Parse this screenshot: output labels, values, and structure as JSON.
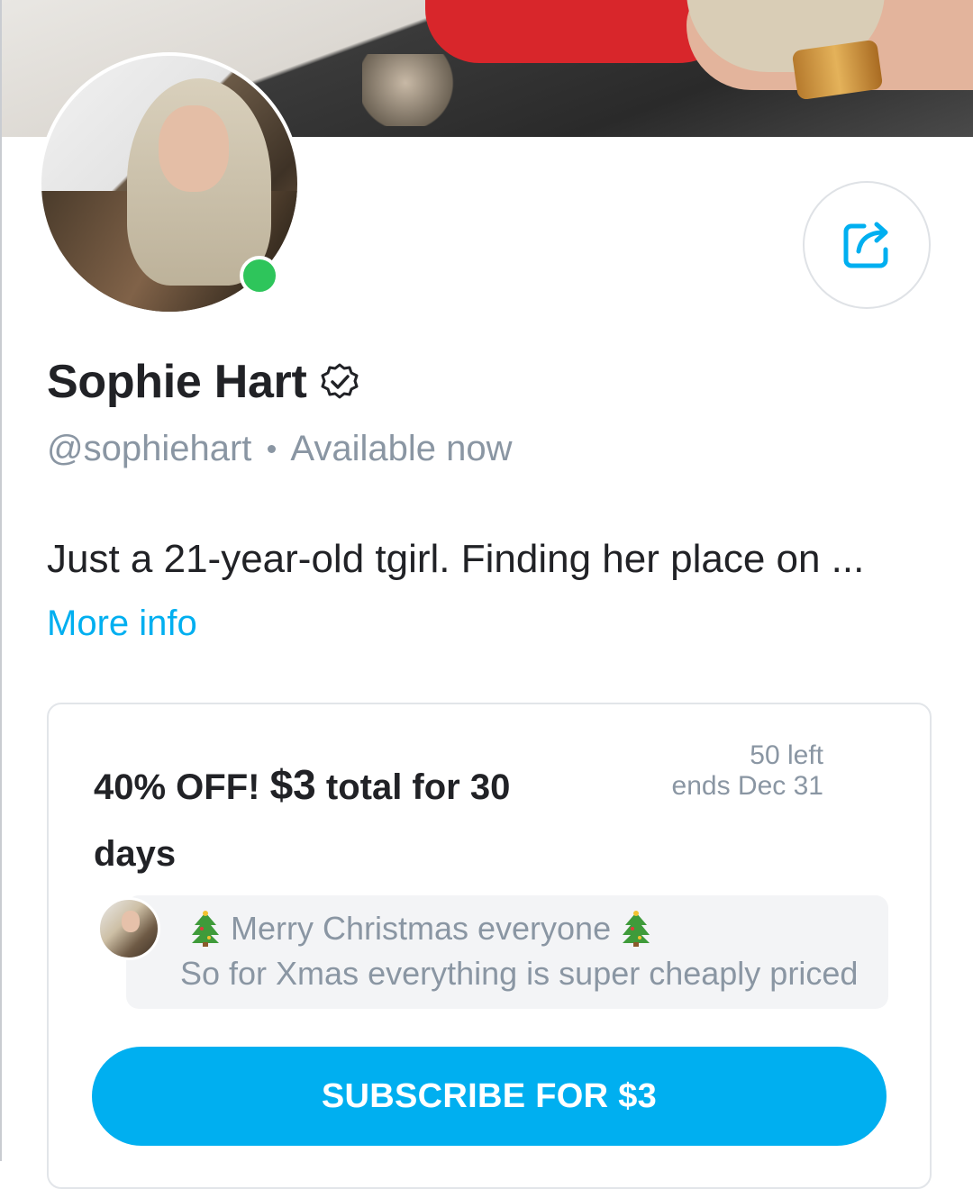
{
  "profile": {
    "name": "Sophie Hart",
    "handle": "@sophiehart",
    "status": "Available now",
    "bio": "Just a 21-year-old tgirl. Finding her place on ...",
    "more_info": "More info",
    "online": true
  },
  "icons": {
    "share": "share-icon",
    "verified": "verified-badge-icon",
    "tree": "christmas-tree-icon"
  },
  "promo": {
    "prefix": "40% OFF! ",
    "price": "$3",
    "suffix": " total for 30 days",
    "left": "50 left",
    "ends": "ends Dec 31",
    "message_line1": "Merry Christmas everyone",
    "message_line2": "So for Xmas everything is super cheaply priced",
    "subscribe_label": "SUBSCRIBE FOR $3"
  },
  "colors": {
    "accent": "#00aff0",
    "online": "#2ec55b",
    "muted_text": "#8a96a3",
    "primary_text": "#212226"
  }
}
